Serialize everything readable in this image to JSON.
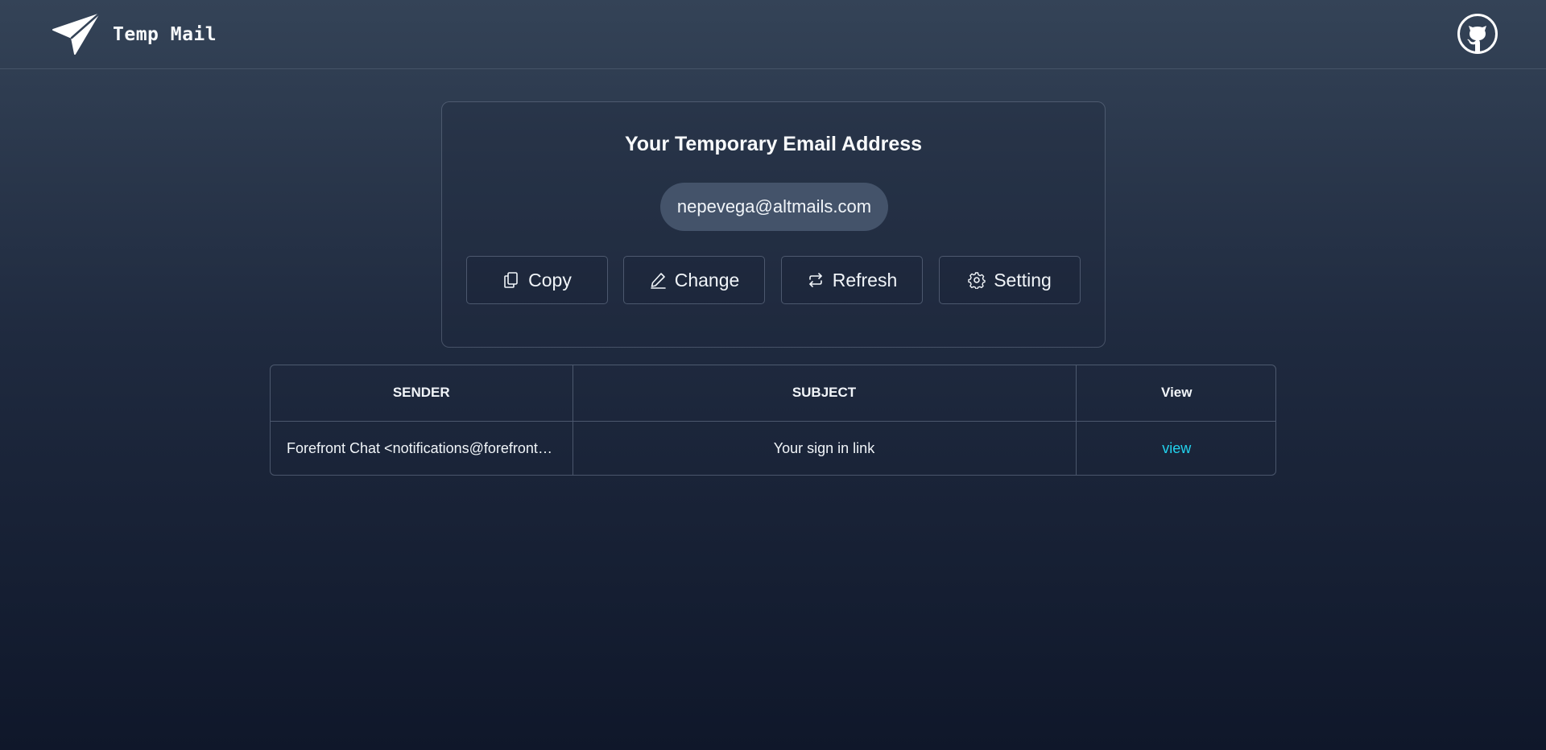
{
  "header": {
    "app_name": "Temp Mail",
    "logo_icon": "paper-plane-icon",
    "github_icon": "github-icon"
  },
  "card": {
    "title": "Your Temporary Email Address",
    "email": "nepevega@altmails.com",
    "buttons": [
      {
        "label": "Copy",
        "icon": "copy-icon"
      },
      {
        "label": "Change",
        "icon": "pencil-icon"
      },
      {
        "label": "Refresh",
        "icon": "refresh-icon"
      },
      {
        "label": "Setting",
        "icon": "gear-icon"
      }
    ]
  },
  "inbox": {
    "columns": [
      "SENDER",
      "SUBJECT",
      "View"
    ],
    "rows": [
      {
        "sender": "Forefront Chat <notifications@forefront.ai>",
        "subject": "Your sign in link",
        "action": "view"
      }
    ]
  },
  "colors": {
    "background_top": "#344357",
    "background_bottom": "#0f172a",
    "pill": "#44536a",
    "link": "#22d3ee"
  }
}
